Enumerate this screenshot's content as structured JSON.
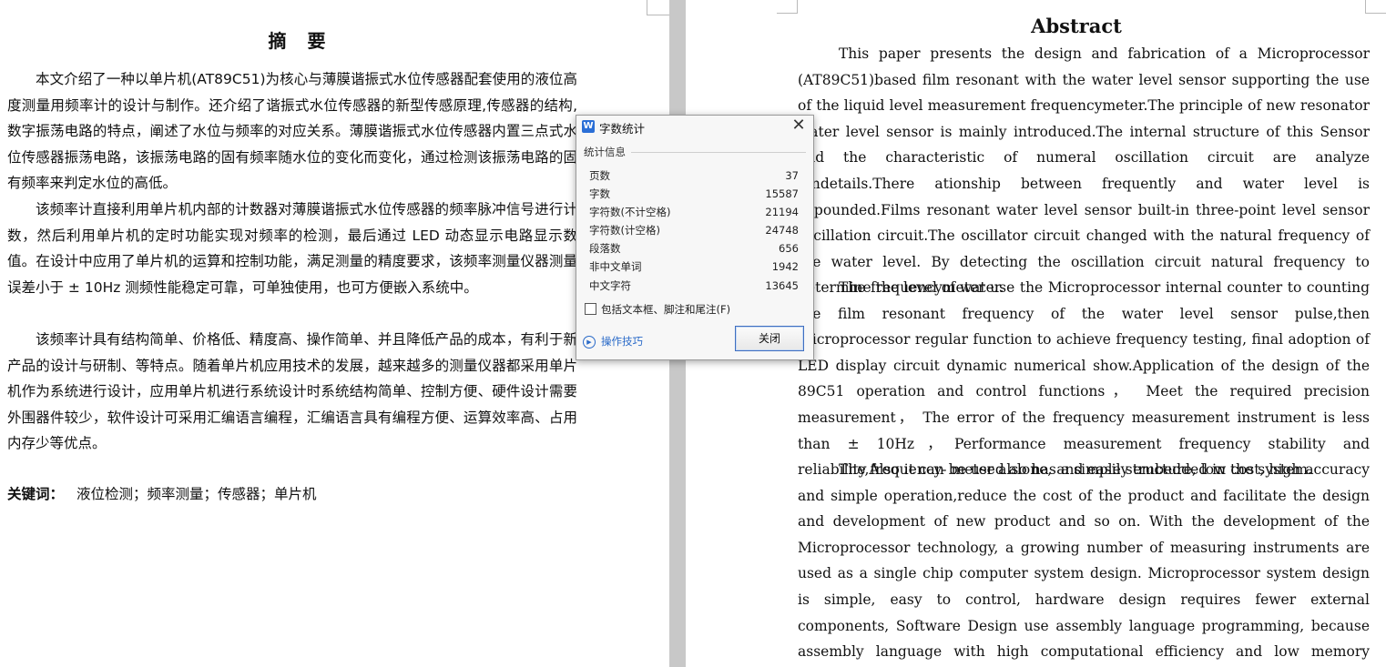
{
  "left_page": {
    "title": "摘 要",
    "paragraphs": [
      "本文介绍了一种以单片机(AT89C51)为核心与薄膜谐振式水位传感器配套使用的液位高度测量用频率计的设计与制作。还介绍了谐振式水位传感器的新型传感原理,传感器的结构,数字振荡电路的特点，阐述了水位与频率的对应关系。薄膜谐振式水位传感器内置三点式水位传感器振荡电路，该振荡电路的固有频率随水位的变化而变化，通过检测该振荡电路的固有频率来判定水位的高低。",
      "该频率计直接利用单片机内部的计数器对薄膜谐振式水位传感器的频率脉冲信号进行计数，然后利用单片机的定时功能实现对频率的检测，最后通过 LED 动态显示电路显示数值。在设计中应用了单片机的运算和控制功能，满足测量的精度要求，该频率测量仪器测量误差小于 ± 10Hz 测频性能稳定可靠，可单独使用，也可方便嵌入系统中。",
      "该频率计具有结构简单、价格低、精度高、操作简单、并且降低产品的成本，有利于新产品的设计与研制、等特点。随着单片机应用技术的发展，越来越多的测量仪器都采用单片机作为系统进行设计，应用单片机进行系统设计时系统结构简单、控制方便、硬件设计需要外围器件较少，软件设计可采用汇编语言编程，汇编语言具有编程方便、运算效率高、占用内存少等优点。"
    ],
    "keywords_label": "关键词：",
    "keywords": "液位检测；频率测量；传感器；单片机"
  },
  "right_page": {
    "title": "Abstract",
    "paragraphs": [
      "This paper presents the design and fabrication of a Microprocessor (AT89C51)based film resonant with the water level sensor supporting the use of the liquid level measurement frequencymeter.The principle of new resonator water level sensor is mainly introduced.The internal structure of this Sensor and the characteristic of numeral oscillation circuit are analyze dindetails.There ationship between frequently and water level is expounded.Films resonant water level sensor built-in three-point level sensor oscillation circuit.The oscillator circuit changed with the natural frequency of the water level. By detecting the oscillation circuit natural frequency to determine the level of water.",
      "The frequencymeter use the Microprocessor  internal counter to counting the film resonant frequency of the water level sensor pulse,then Microprocessor regular function to achieve frequency testing, final adoption of LED display circuit dynamic numerical show.Application of the design of the 89C51 operation and control functions， Meet the required precision measurement， The error of the frequency measurement instrument is less than  ± 10Hz，Performance measurement frequency stability and reliability,Also it can be used alone, and easily embedded in the system.",
      "The frequency- meter also has a simple structure, low cost, high accuracy and simple operation,reduce the cost of the product and facilitate the design and development of new product and so on. With the development of the Microprocessor technology, a growing number of measuring instruments are used as a single chip computer system design. Microprocessor system design is simple, easy to control, hardware design requires fewer external components, Software Design use assembly language programming, because assembly language with high computational efficiency and low memory  consume."
    ]
  },
  "dialog": {
    "icon": "W",
    "title": "字数统计",
    "close_glyph": "✕",
    "group_label": "统计信息",
    "stats": [
      {
        "label": "页数",
        "value": "37"
      },
      {
        "label": "字数",
        "value": "15587"
      },
      {
        "label": "字符数(不计空格)",
        "value": "21194"
      },
      {
        "label": "字符数(计空格)",
        "value": "24748"
      },
      {
        "label": "段落数",
        "value": "656"
      },
      {
        "label": "非中文单词",
        "value": "1942"
      },
      {
        "label": "中文字符",
        "value": "13645"
      }
    ],
    "checkbox_label": "包括文本框、脚注和尾注(F)",
    "checkbox_checked": false,
    "tips_label": "操作技巧",
    "close_button_label": "关闭"
  }
}
